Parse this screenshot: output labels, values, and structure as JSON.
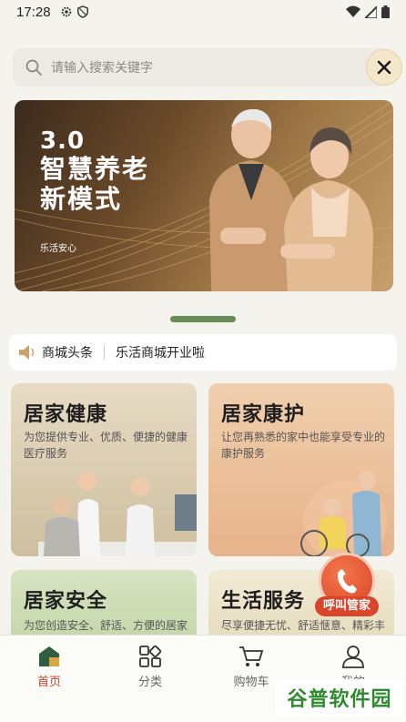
{
  "status_bar": {
    "time": "17:28"
  },
  "search": {
    "placeholder": "请输入搜索关键字"
  },
  "banner": {
    "line1": "3.0",
    "line2": "智慧养老",
    "line3": "新模式",
    "tag": "乐活安心"
  },
  "news": {
    "label": "商城头条",
    "headline": "乐活商城开业啦"
  },
  "cards": [
    {
      "title": "居家健康",
      "desc": "为您提供专业、优质、便捷的健康医疗服务"
    },
    {
      "title": "居家康护",
      "desc": "让您再熟悉的家中也能享受专业的康护服务"
    },
    {
      "title": "居家安全",
      "desc": "为您创造安全、舒适、方便的居家生活环境"
    },
    {
      "title": "生活服务",
      "desc": "尽享便捷无忧、舒适惬意、精彩丰富的生活"
    }
  ],
  "floating": {
    "label": "呼叫管家"
  },
  "tabbar": {
    "items": [
      {
        "label": "首页"
      },
      {
        "label": "分类"
      },
      {
        "label": "购物车"
      },
      {
        "label": "我的"
      }
    ]
  },
  "watermark": "谷普软件园",
  "colors": {
    "accent": "#c3442c",
    "pager": "#6a8a5a",
    "floating": "#d9452a"
  }
}
